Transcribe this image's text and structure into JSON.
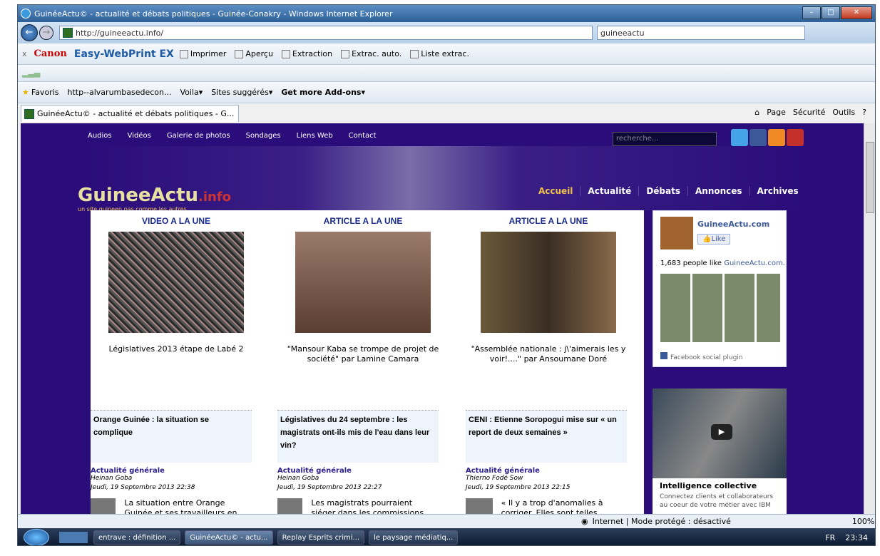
{
  "window": {
    "title": "GuinéeActu© - actualité et débats politiques - Guinée-Conakry - Windows Internet Explorer"
  },
  "address_bar": {
    "url": "http://guineeactu.info/",
    "search_value": "guineeactu"
  },
  "canon_toolbar": {
    "close": "x",
    "brand": "Canon",
    "product": "Easy-WebPrint EX",
    "items": [
      "Imprimer",
      "Aperçu",
      "Extraction",
      "Extrac. auto.",
      "Liste extrac."
    ]
  },
  "favorites_bar": {
    "favorites_label": "Favoris",
    "items": [
      "http--alvarumbasedecon...",
      "Voila",
      "Sites suggérés",
      "Get more Add-ons"
    ]
  },
  "tab": {
    "label": "GuinéeActu© - actualité et débats politiques - G..."
  },
  "command_bar": {
    "items": [
      "Page",
      "Sécurité",
      "Outils"
    ]
  },
  "site": {
    "top_links": [
      "Audios",
      "Vidéos",
      "Galerie de photos",
      "Sondages",
      "Liens Web",
      "Contact"
    ],
    "search_placeholder": "recherche...",
    "logo": "GuineeActu",
    "logo_suffix": ".info",
    "tagline": "un site guineen pas comme les autres",
    "main_nav": [
      "Accueil",
      "Actualité",
      "Débats",
      "Annonces",
      "Archives"
    ],
    "featured": [
      {
        "heading": "VIDEO A LA UNE",
        "caption": "Législatives 2013 étape de Labé 2"
      },
      {
        "heading": "ARTICLE A LA UNE",
        "caption": "\"Mansour Kaba se trompe de projet de société\" par Lamine Camara"
      },
      {
        "heading": "ARTICLE A LA UNE",
        "caption": "\"Assemblée nationale : j\\'aimerais les y voir!....\" par Ansoumane Doré"
      }
    ],
    "articles": [
      {
        "title": "Orange Guinée : la situation se complique",
        "category": "Actualité générale",
        "author": "Heinan Goba",
        "date": "Jeudi, 19 Septembre 2013 22:38",
        "excerpt": "La situation entre Orange Guinée et ses travailleurs en"
      },
      {
        "title": "Législatives du 24 septembre : les magistrats ont-ils mis de l'eau dans leur vin?",
        "category": "Actualité générale",
        "author": "Heinan Goba",
        "date": "Jeudi, 19 Septembre 2013 22:27",
        "excerpt": "Les magistrats pourraient siéger dans les commissions"
      },
      {
        "title": "CENI : Etienne Soropogui mise sur « un report de deux semaines »",
        "category": "Actualité générale",
        "author": "Thierno Fodé Sow",
        "date": "Jeudi, 19 Septembre 2013 22:15",
        "excerpt": "« Il y a trop d'anomalies à corriger. Elles sont telles"
      }
    ],
    "facebook": {
      "page_name": "GuineeActu.com",
      "like_label": "Like",
      "count_text": "1,683 people like",
      "page_link": "GuineeActu.com.",
      "plugin_label": "Facebook social plugin"
    },
    "ad": {
      "title": "Intelligence collective",
      "text": "Connectez clients et collaborateurs au coeur de votre métier avec IBM"
    }
  },
  "status_bar": {
    "zone": "Internet | Mode protégé : désactivé",
    "zoom": "100%"
  },
  "taskbar": {
    "tasks": [
      "entrave : définition ...",
      "GuinéeActu© - actu...",
      "Replay Esprits crimi...",
      "le paysage médiatiq..."
    ],
    "lang": "FR",
    "clock": "23:34"
  },
  "colors": {
    "site_bg": "#2a0d7a",
    "accent": "#f0c24a",
    "heading": "#1a2a8a"
  }
}
